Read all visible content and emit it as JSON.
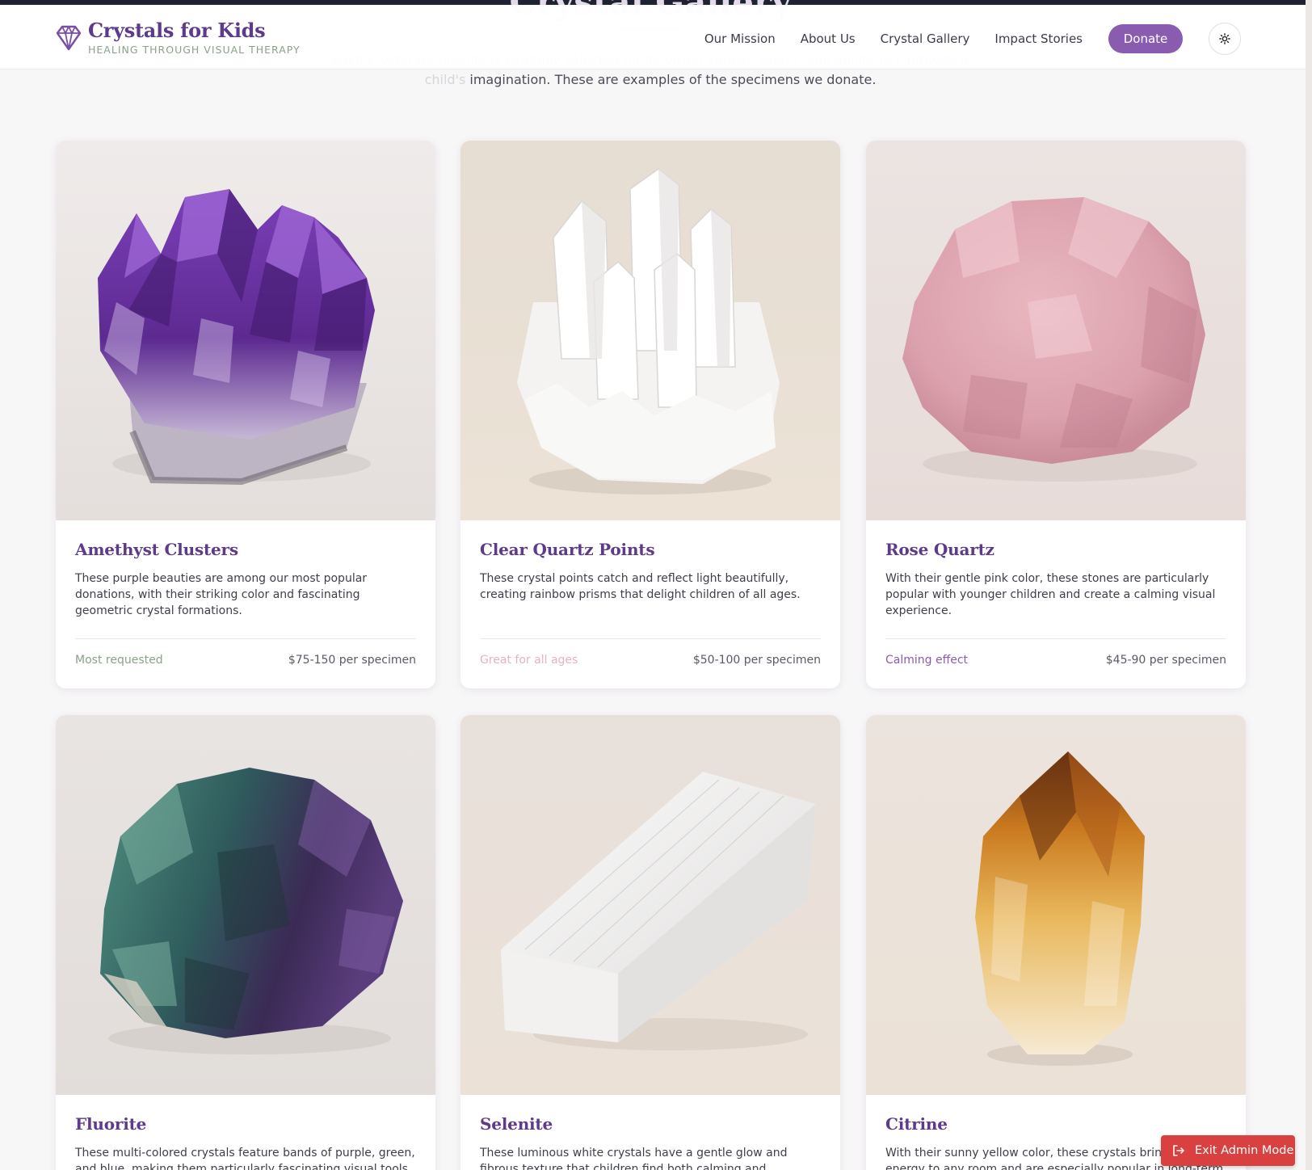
{
  "section": {
    "title": "Crystal Gallery",
    "desc_faded": "Each crystal we provide is carefully selected for its visual appeal, safety, and ability to captivate a child's",
    "desc_visible": "imagination. These are examples of the specimens we donate."
  },
  "header": {
    "brand_name": "Crystals for Kids",
    "brand_tagline": "HEALING THROUGH VISUAL THERAPY",
    "nav": [
      "Our Mission",
      "About Us",
      "Crystal Gallery",
      "Impact Stories"
    ],
    "donate_label": "Donate",
    "theme_icon": "sun-icon",
    "brand_color": "#5e3b8a",
    "accent_color": "#8a5cb0"
  },
  "crystals": [
    {
      "name": "Amethyst Clusters",
      "desc": "These purple beauties are among our most popular donations, with their striking color and fascinating geometric crystal formations.",
      "tag": "Most requested",
      "price": "$75-150 per specimen"
    },
    {
      "name": "Clear Quartz Points",
      "desc": "These crystal points catch and reflect light beautifully, creating rainbow prisms that delight children of all ages.",
      "tag": "Great for all ages",
      "price": "$50-100 per specimen"
    },
    {
      "name": "Rose Quartz",
      "desc": "With their gentle pink color, these stones are particularly popular with younger children and create a calming visual experience.",
      "tag": "Calming effect",
      "price": "$45-90 per specimen"
    },
    {
      "name": "Fluorite",
      "desc": "These multi-colored crystals feature bands of purple, green, and blue, making them particularly fascinating visual tools."
    },
    {
      "name": "Selenite",
      "desc": "These luminous white crystals have a gentle glow and fibrous texture that children find both calming and intriguing."
    },
    {
      "name": "Citrine",
      "desc": "With their sunny yellow color, these crystals bring a bright energy to any room and are especially popular in long-term care"
    }
  ],
  "admin": {
    "exit_label": "Exit Admin Mode",
    "color": "#d94040"
  }
}
